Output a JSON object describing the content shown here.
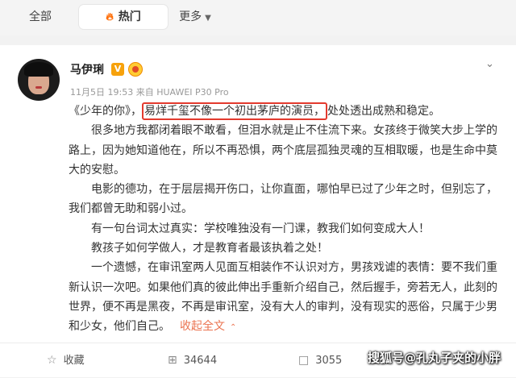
{
  "tabs": {
    "all": "全部",
    "hot": "热门",
    "more": "更多",
    "hot_icon": "fire-icon",
    "more_icon": "chevron-down-icon"
  },
  "post": {
    "author": "马伊琍",
    "badge_v": "V",
    "date": "11月5日 19:53",
    "source": "来自 HUAWEI P30 Pro",
    "lines": {
      "l1_pre": "《少年的你》，",
      "l1_hl": "易烊千玺不像一个初出茅庐的演员，",
      "l1_post": "处处透出成熟和稳定。",
      "p2": "很多地方我都闭着眼不敢看，但泪水就是止不住流下来。女孩终于微笑大步上学的路上，因为她知道他在，所以不再恐惧，两个底层孤独灵魂的互相取暖，也是生命中莫大的安慰。",
      "p3": "电影的德功，在于层层揭开伤口，让你直面，哪怕早已过了少年之时，但别忘了，我们都曾无助和弱小过。",
      "p4": "有一句台词太过真实：学校唯独没有一门课，教我们如何变成大人！",
      "p5": "教孩子如何学做人，才是教育者最该执着之处！",
      "p6": "一个遗憾，在审讯室两人见面互相装作不认识对方，男孩戏谑的表情：要不我们重新认识一次吧。如果他们真的彼此伸出手重新介绍自己，然后握手，旁若无人，此刻的世界，便不再是黑夜，不再是审讯室，没有大人的审判，没有现实的恶俗，只属于少男和少女，他们自己。"
    },
    "expand_label": "收起全文",
    "expand_icon": "chevron-up-icon",
    "highlight_color": "#e33a2e"
  },
  "actions": {
    "favorite": "收藏",
    "repost": "34644",
    "comment": "3055"
  },
  "watermark": "搜狐号@孔丸子夹的小胖"
}
